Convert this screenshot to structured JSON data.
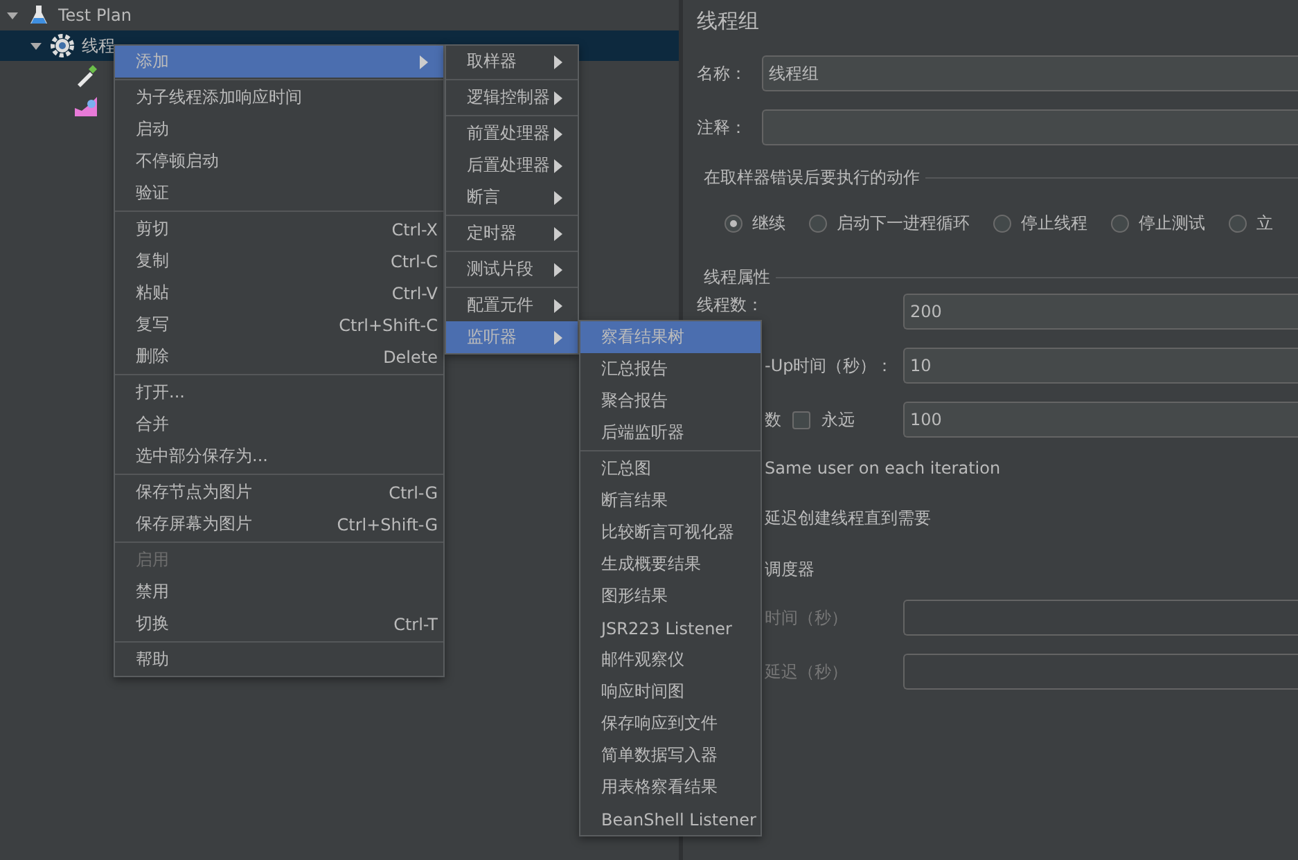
{
  "tree": [
    {
      "label": "Test Plan",
      "kind": "plan",
      "expanded": true,
      "selected": false,
      "children": [
        {
          "label": "线程",
          "kind": "thread_group",
          "expanded": true,
          "selected": true,
          "children": [
            {
              "kind": "sampler",
              "selected": false
            },
            {
              "kind": "listener",
              "selected": false
            }
          ]
        }
      ]
    }
  ],
  "context_menu": {
    "groups": [
      [
        {
          "label": "添加",
          "submenu": true,
          "selected": true,
          "disabled": false
        }
      ],
      [
        {
          "label": "为子线程添加响应时间",
          "submenu": false,
          "selected": false,
          "disabled": false
        },
        {
          "label": "启动",
          "submenu": false,
          "selected": false,
          "disabled": false
        },
        {
          "label": "不停顿启动",
          "submenu": false,
          "selected": false,
          "disabled": false
        },
        {
          "label": "验证",
          "submenu": false,
          "selected": false,
          "disabled": false
        }
      ],
      [
        {
          "label": "剪切",
          "shortcut": "Ctrl-X",
          "submenu": false,
          "selected": false,
          "disabled": false
        },
        {
          "label": "复制",
          "shortcut": "Ctrl-C",
          "submenu": false,
          "selected": false,
          "disabled": false
        },
        {
          "label": "粘贴",
          "shortcut": "Ctrl-V",
          "submenu": false,
          "selected": false,
          "disabled": false
        },
        {
          "label": "复写",
          "shortcut": "Ctrl+Shift-C",
          "submenu": false,
          "selected": false,
          "disabled": false
        },
        {
          "label": "删除",
          "shortcut": "Delete",
          "submenu": false,
          "selected": false,
          "disabled": false
        }
      ],
      [
        {
          "label": "打开...",
          "submenu": false,
          "selected": false,
          "disabled": false
        },
        {
          "label": "合并",
          "submenu": false,
          "selected": false,
          "disabled": false
        },
        {
          "label": "选中部分保存为...",
          "submenu": false,
          "selected": false,
          "disabled": false
        }
      ],
      [
        {
          "label": "保存节点为图片",
          "shortcut": "Ctrl-G",
          "submenu": false,
          "selected": false,
          "disabled": false
        },
        {
          "label": "保存屏幕为图片",
          "shortcut": "Ctrl+Shift-G",
          "submenu": false,
          "selected": false,
          "disabled": false
        }
      ],
      [
        {
          "label": "启用",
          "submenu": false,
          "selected": false,
          "disabled": true
        },
        {
          "label": "禁用",
          "submenu": false,
          "selected": false,
          "disabled": false
        },
        {
          "label": "切换",
          "shortcut": "Ctrl-T",
          "submenu": false,
          "selected": false,
          "disabled": false
        }
      ],
      [
        {
          "label": "帮助",
          "submenu": false,
          "selected": false,
          "disabled": false
        }
      ]
    ]
  },
  "add_submenu": {
    "groups": [
      [
        {
          "label": "取样器",
          "submenu": true,
          "selected": false,
          "disabled": false
        }
      ],
      [
        {
          "label": "逻辑控制器",
          "submenu": true,
          "selected": false,
          "disabled": false
        }
      ],
      [
        {
          "label": "前置处理器",
          "submenu": true,
          "selected": false,
          "disabled": false
        },
        {
          "label": "后置处理器",
          "submenu": true,
          "selected": false,
          "disabled": false
        },
        {
          "label": "断言",
          "submenu": true,
          "selected": false,
          "disabled": false
        }
      ],
      [
        {
          "label": "定时器",
          "submenu": true,
          "selected": false,
          "disabled": false
        }
      ],
      [
        {
          "label": "测试片段",
          "submenu": true,
          "selected": false,
          "disabled": false
        }
      ],
      [
        {
          "label": "配置元件",
          "submenu": true,
          "selected": false,
          "disabled": false
        },
        {
          "label": "监听器",
          "submenu": true,
          "selected": true,
          "disabled": false
        }
      ]
    ]
  },
  "listener_submenu": {
    "groups": [
      [
        {
          "label": "察看结果树",
          "submenu": false,
          "selected": true,
          "disabled": false
        },
        {
          "label": "汇总报告",
          "submenu": false,
          "selected": false,
          "disabled": false
        },
        {
          "label": "聚合报告",
          "submenu": false,
          "selected": false,
          "disabled": false
        },
        {
          "label": "后端监听器",
          "submenu": false,
          "selected": false,
          "disabled": false
        }
      ],
      [
        {
          "label": "汇总图",
          "submenu": false,
          "selected": false,
          "disabled": false
        },
        {
          "label": "断言结果",
          "submenu": false,
          "selected": false,
          "disabled": false
        },
        {
          "label": "比较断言可视化器",
          "submenu": false,
          "selected": false,
          "disabled": false
        },
        {
          "label": "生成概要结果",
          "submenu": false,
          "selected": false,
          "disabled": false
        },
        {
          "label": "图形结果",
          "submenu": false,
          "selected": false,
          "disabled": false
        },
        {
          "label": "JSR223 Listener",
          "submenu": false,
          "selected": false,
          "disabled": false
        },
        {
          "label": "邮件观察仪",
          "submenu": false,
          "selected": false,
          "disabled": false
        },
        {
          "label": "响应时间图",
          "submenu": false,
          "selected": false,
          "disabled": false
        },
        {
          "label": "保存响应到文件",
          "submenu": false,
          "selected": false,
          "disabled": false
        },
        {
          "label": "简单数据写入器",
          "submenu": false,
          "selected": false,
          "disabled": false
        },
        {
          "label": "用表格察看结果",
          "submenu": false,
          "selected": false,
          "disabled": false
        },
        {
          "label": "BeanShell Listener",
          "submenu": false,
          "selected": false,
          "disabled": false
        }
      ]
    ]
  },
  "panel": {
    "title": "线程组",
    "name_field": {
      "label": "名称：",
      "value": "线程组"
    },
    "comment_field": {
      "label": "注释："
    },
    "error_action": {
      "title": "在取样器错误后要执行的动作",
      "options": [
        {
          "label": "继续",
          "selected": true
        },
        {
          "label": "启动下一进程循环",
          "selected": false
        },
        {
          "label": "停止线程",
          "selected": false
        },
        {
          "label": "停止测试",
          "selected": false
        },
        {
          "label": "立",
          "selected": false
        }
      ]
    },
    "thread_properties": {
      "title": "线程属性",
      "rows": [
        {
          "kind": "field",
          "label": "线程数：",
          "value": "200",
          "indent": false,
          "disabled": false
        },
        {
          "kind": "field",
          "label": "-Up时间（秒）：",
          "value": "10",
          "indent": true,
          "disabled": false
        },
        {
          "kind": "loop",
          "label": "数",
          "forever": {
            "label": "永远",
            "checked": false
          },
          "value": "100",
          "indent": true,
          "disabled": false
        },
        {
          "kind": "text",
          "label": "Same user on each iteration",
          "indent": true,
          "disabled": false
        },
        {
          "kind": "text",
          "label": "延迟创建线程直到需要",
          "indent": true,
          "disabled": false
        },
        {
          "kind": "text",
          "label": "调度器",
          "indent": true,
          "disabled": false
        },
        {
          "kind": "field",
          "label": "时间（秒）",
          "indent": true,
          "disabled": true
        },
        {
          "kind": "field",
          "label": "延迟（秒）",
          "indent": true,
          "disabled": true
        }
      ]
    }
  }
}
